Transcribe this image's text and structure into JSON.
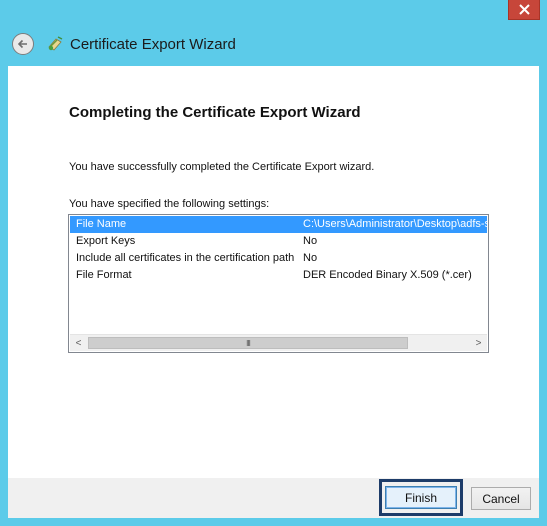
{
  "window": {
    "title": "Certificate Export Wizard",
    "close_label": "×"
  },
  "page": {
    "heading": "Completing the Certificate Export Wizard",
    "message": "You have successfully completed the Certificate Export wizard.",
    "settings_label": "You have specified the following settings:"
  },
  "settings": [
    {
      "key": "File Name",
      "value": "C:\\Users\\Administrator\\Desktop\\adfs-s",
      "selected": true
    },
    {
      "key": "Export Keys",
      "value": "No"
    },
    {
      "key": "Include all certificates in the certification path",
      "value": "No"
    },
    {
      "key": "File Format",
      "value": "DER Encoded Binary X.509 (*.cer)"
    }
  ],
  "scrollbar": {
    "left_arrow": "<",
    "right_arrow": ">",
    "grip": "III"
  },
  "buttons": {
    "finish": "Finish",
    "cancel": "Cancel"
  },
  "colors": {
    "chrome": "#5ccbe9",
    "selection": "#3399ff",
    "close": "#c7463a"
  }
}
